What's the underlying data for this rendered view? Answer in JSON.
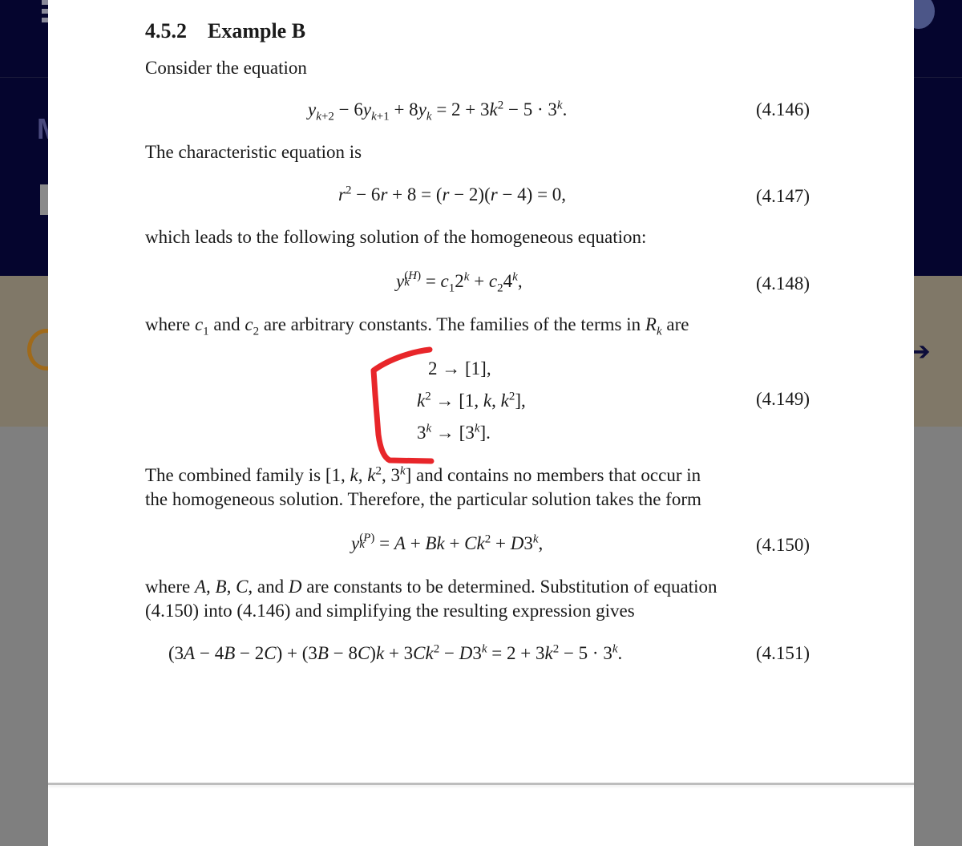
{
  "background": {
    "menu_icon": "hamburger-menu-icon",
    "partial_letter": "M",
    "left_icon": "ring-icon",
    "right_icon": "arrow-right-icon",
    "colors": {
      "header": "#05052e",
      "band": "#807868",
      "overlay": "#7f7f7f",
      "ring": "#a06a1a",
      "annotation": "#e8262a"
    }
  },
  "document": {
    "section_number": "4.5.2",
    "section_title": "Example B",
    "p1": "Consider the equation",
    "eq146": {
      "text": "y_{k+2} − 6y_{k+1} + 8y_k = 2 + 3k² − 5 · 3^k.",
      "number": "(4.146)"
    },
    "p2": "The characteristic equation is",
    "eq147": {
      "text": "r² − 6r + 8 = (r − 2)(r − 4) = 0,",
      "number": "(4.147)"
    },
    "p3": "which leads to the following solution of the homogeneous equation:",
    "eq148": {
      "text": "y_k^(H) = c₁2^k + c₂4^k,",
      "number": "(4.148)"
    },
    "p4": "where c₁ and c₂ are arbitrary constants. The families of the terms in R_k are",
    "eq149": {
      "rows": [
        "2 → [1],",
        "k² → [1, k, k²],",
        "3^k → [3^k]."
      ],
      "number": "(4.149)"
    },
    "p5_line1": "The combined family is [1, k, k², 3^k] and contains no members that occur in",
    "p5_line2": "the homogeneous solution. Therefore, the particular solution takes the form",
    "eq150": {
      "text": "y_k^(P) = A + Bk + Ck² + D3^k,",
      "number": "(4.150)"
    },
    "p6_line1": "where A, B, C, and D are constants to be determined. Substitution of equation",
    "p6_line2": "(4.150) into (4.146) and simplifying the resulting expression gives",
    "eq151": {
      "text": "(3A − 4B − 2C) + (3B − 8C)k + 3Ck² − D3^k = 2 + 3k² − 5 · 3^k.",
      "number": "(4.151)"
    }
  }
}
